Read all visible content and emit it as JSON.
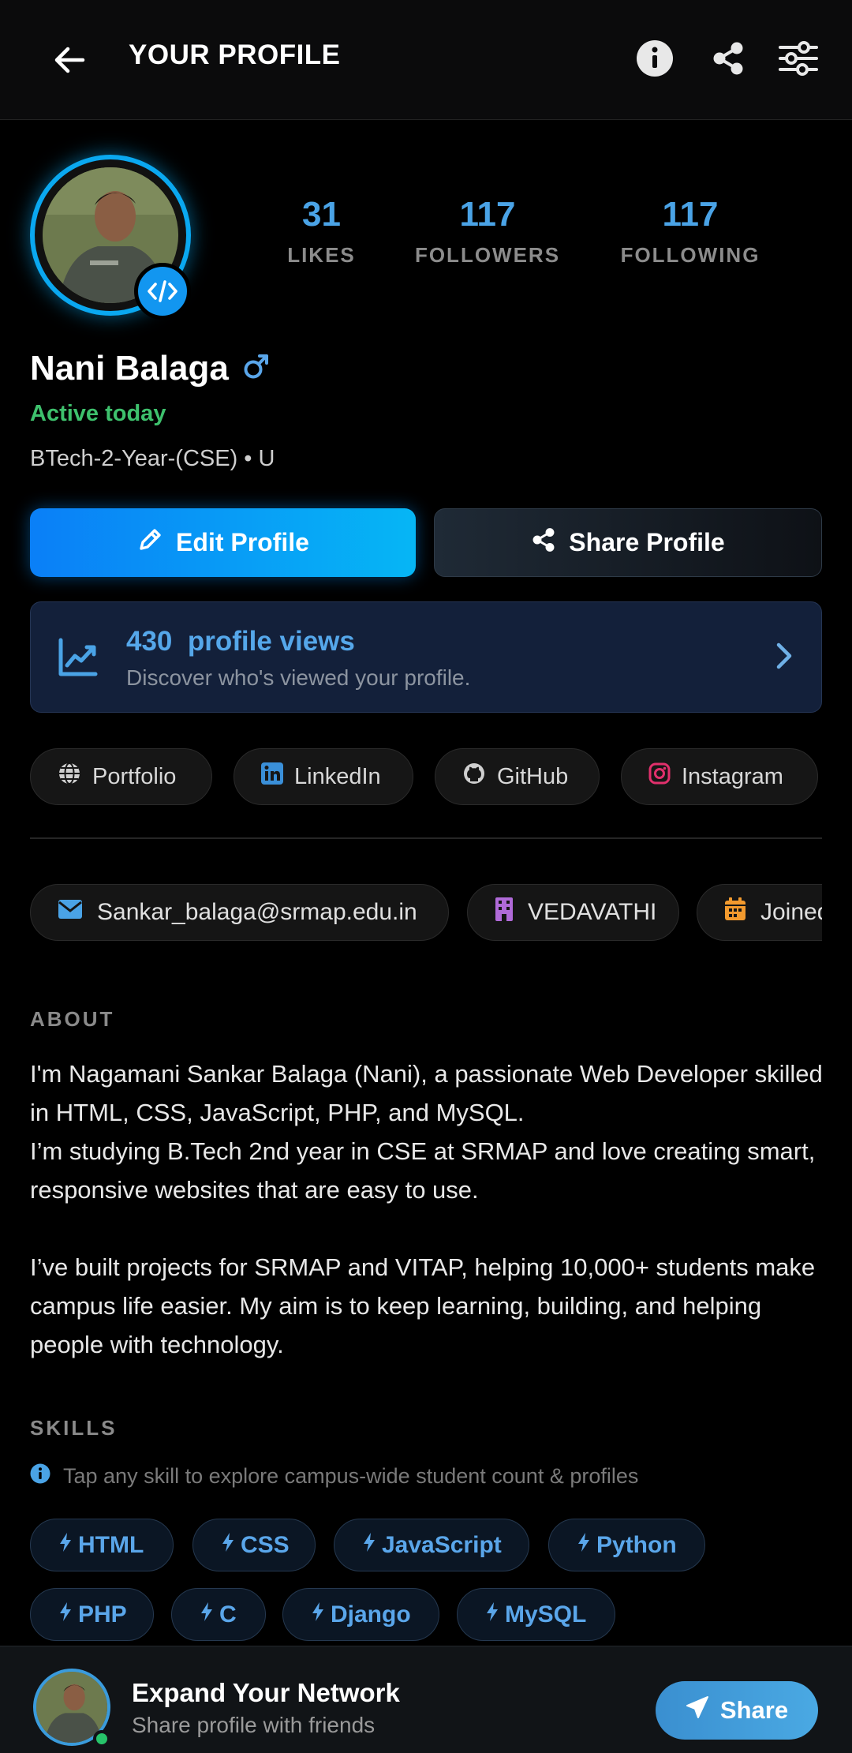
{
  "header": {
    "title": "YOUR PROFILE",
    "icons": [
      "back-arrow-icon",
      "info-icon",
      "share-icon",
      "settings-sliders-icon"
    ]
  },
  "profile": {
    "name": "Nani Balaga",
    "status": "Active today",
    "meta": "BTech-2-Year-(CSE) • U",
    "gender_icon": "male-icon"
  },
  "stats": [
    {
      "value": "31",
      "label": "LIKES"
    },
    {
      "value": "117",
      "label": "FOLLOWERS"
    },
    {
      "value": "117",
      "label": "FOLLOWING"
    }
  ],
  "actions": {
    "edit_label": "Edit Profile",
    "share_label": "Share Profile"
  },
  "views": {
    "title": "430  profile views",
    "subtitle": "Discover who's viewed your profile."
  },
  "links": [
    {
      "label": "Portfolio",
      "icon": "globe-icon"
    },
    {
      "label": "LinkedIn",
      "icon": "linkedin-icon"
    },
    {
      "label": "GitHub",
      "icon": "github-icon"
    },
    {
      "label": "Instagram",
      "icon": "instagram-icon"
    }
  ],
  "info": {
    "email": "Sankar_balaga@srmap.edu.in",
    "hostel": "VEDAVATHI",
    "joined": "Joined"
  },
  "about": {
    "heading": "ABOUT",
    "paragraph1": "I'm Nagamani Sankar Balaga (Nani), a passionate Web Developer skilled in HTML, CSS, JavaScript, PHP, and MySQL.",
    "paragraph2": "I’m studying B.Tech 2nd year in CSE at SRMAP and love creating smart, responsive websites that are easy to use.",
    "paragraph3": "I’ve built projects for SRMAP and VITAP, helping 10,000+ students make campus life easier. My aim is to keep learning, building, and helping people with technology."
  },
  "skills": {
    "heading": "SKILLS",
    "hint": "Tap any skill to explore campus-wide student count & profiles",
    "items": [
      "HTML",
      "CSS",
      "JavaScript",
      "Python",
      "PHP",
      "C",
      "Django",
      "MySQL"
    ]
  },
  "bottom_bar": {
    "title": "Expand Your Network",
    "subtitle": "Share profile with friends",
    "button_label": "Share"
  },
  "colors": {
    "accent": "#0aa8f0",
    "active_green": "#3ec16d",
    "skill_text": "#5aa6ea"
  }
}
